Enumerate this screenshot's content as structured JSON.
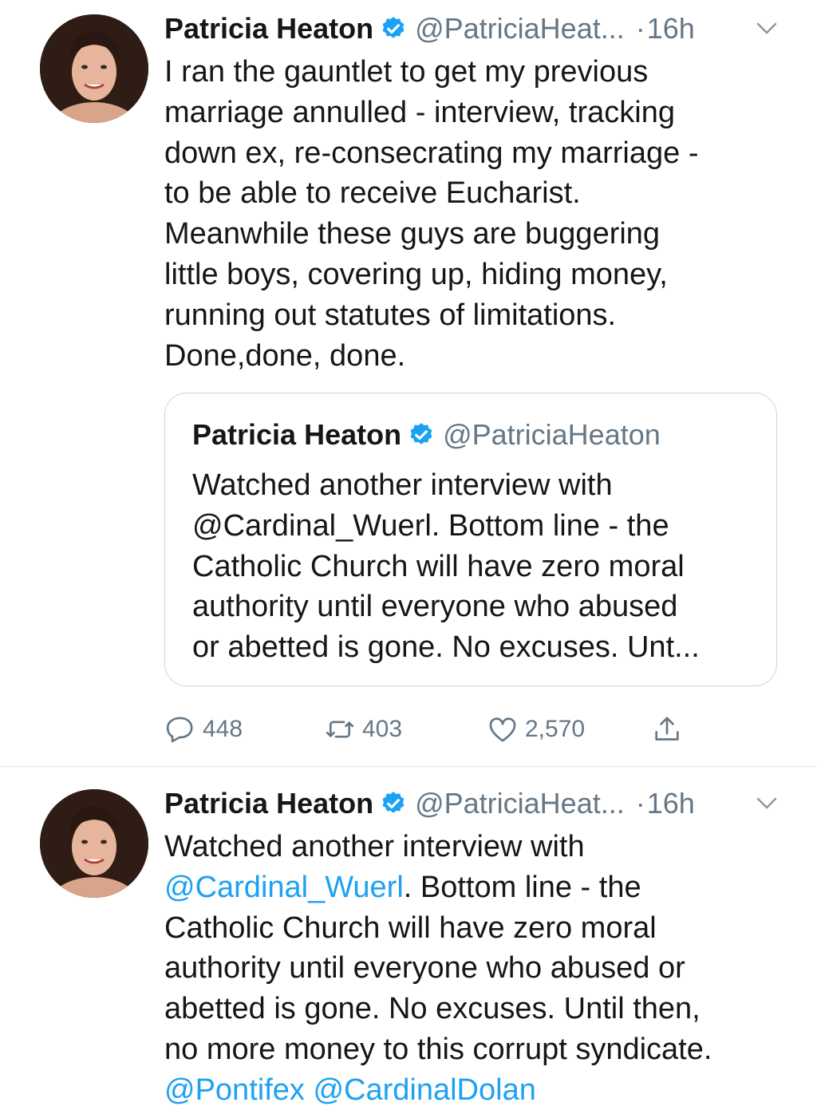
{
  "tweets": [
    {
      "author_name": "Patricia Heaton",
      "handle": "@PatriciaHeat...",
      "separator": "·",
      "time": "16h",
      "text": "I ran the gauntlet to get my previous\nmarriage annulled - interview, tracking\ndown ex, re-consecrating my marriage -\nto be able to receive Eucharist.\nMeanwhile these guys are buggering\nlittle boys, covering up, hiding money,\nrunning out statutes of limitations.\nDone,done, done.",
      "quoted": {
        "author_name": "Patricia Heaton",
        "handle": "@PatriciaHeaton",
        "text": "Watched another interview with\n@Cardinal_Wuerl. Bottom line - the\nCatholic Church will have zero moral\nauthority until everyone who abused\nor abetted is gone. No excuses. Unt..."
      },
      "actions": {
        "replies": "448",
        "retweets": "403",
        "likes": "2,570"
      }
    },
    {
      "author_name": "Patricia Heaton",
      "handle": "@PatriciaHeat...",
      "separator": "·",
      "time": "16h",
      "text_line1": "Watched another interview with",
      "mention1": "@Cardinal_Wuerl",
      "text_line2_rest": ". Bottom line - the",
      "text_rest": "Catholic Church will have zero moral\nauthority until everyone who abused or\nabetted is gone. No excuses. Until then,\nno more money to this corrupt syndicate.",
      "mention2": "@Pontifex",
      "mention3": "@CardinalDolan"
    }
  ],
  "colors": {
    "text": "#14171a",
    "secondary": "#657786",
    "link": "#1da1f2",
    "border": "#ccd6dd"
  },
  "icons": [
    "verified-badge-icon",
    "chevron-down-icon",
    "reply-icon",
    "retweet-icon",
    "like-icon",
    "share-icon"
  ]
}
